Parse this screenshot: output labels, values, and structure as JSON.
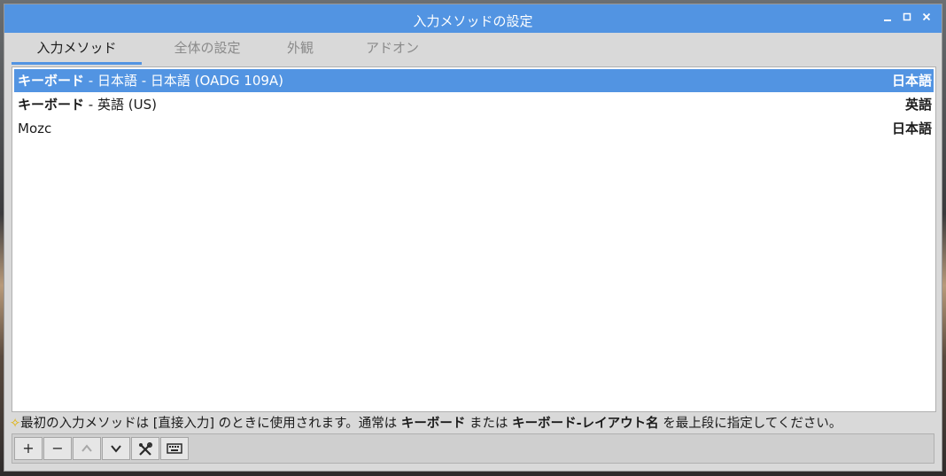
{
  "window": {
    "title": "入力メソッドの設定",
    "controls": {
      "minimize": "_",
      "maximize": "□",
      "close": "×"
    }
  },
  "tabs": [
    {
      "label": "入力メソッド",
      "active": true
    },
    {
      "label": "全体の設定",
      "active": false
    },
    {
      "label": "外観",
      "active": false
    },
    {
      "label": "アドオン",
      "active": false
    }
  ],
  "methods": [
    {
      "name_bold": "キーボード",
      "name_rest": " - 日本語 - 日本語 (OADG 109A)",
      "language": "日本語",
      "selected": true
    },
    {
      "name_bold": "キーボード",
      "name_rest": " - 英語 (US)",
      "language": "英語",
      "selected": false
    },
    {
      "name_bold": "",
      "name_rest": "Mozc",
      "language": "日本語",
      "selected": false
    }
  ],
  "hint": {
    "star": "✧",
    "part1": "最初の入力メソッドは [直接入力] のときに使用されます。通常は ",
    "bold1": "キーボード",
    "part2": " または ",
    "bold2": "キーボード-レイアウト名",
    "part3": " を最上段に指定してください。"
  },
  "toolbar": {
    "add": "+",
    "remove": "−",
    "up": "︿",
    "down": "﹀",
    "configure_icon": "tools-icon",
    "keyboard_icon": "keyboard-icon"
  },
  "colors": {
    "accent": "#5294e2",
    "window_bg": "#d9d9d9"
  }
}
